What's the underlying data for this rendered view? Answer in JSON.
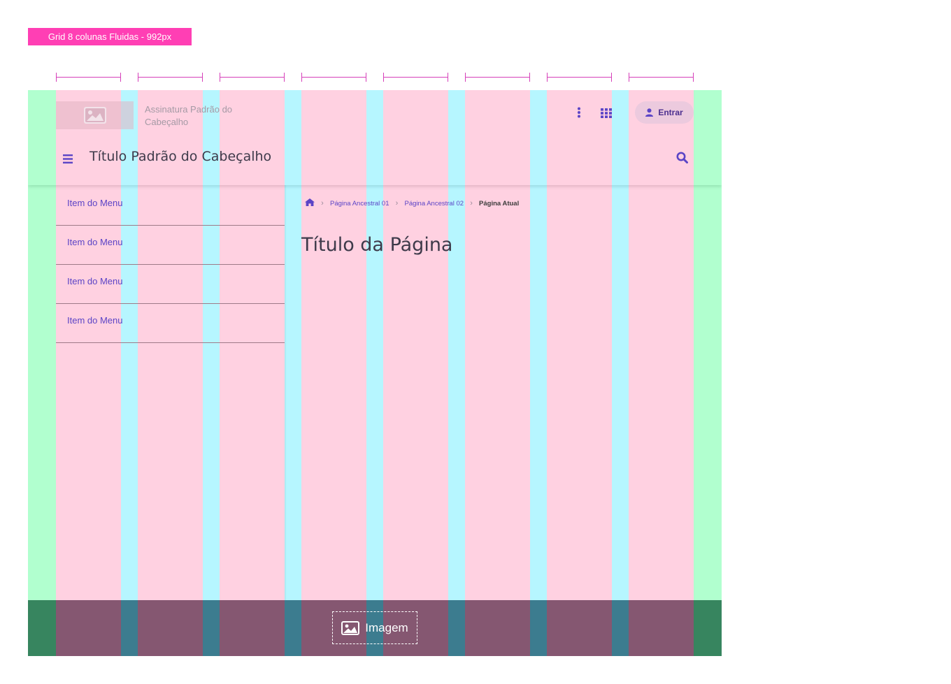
{
  "annotation": {
    "grid_label": "Grid 8 colunas Fluidas - 992px",
    "columns": 8
  },
  "colors": {
    "accent": "#5b44c6",
    "grid_label_bg": "#ff3fb4",
    "column": "#ffa4c4",
    "gutter": "#6eeeff",
    "margin": "#64ffa0",
    "footer": "#0a0a1e"
  },
  "header": {
    "logo_icon": "image-icon",
    "signature": "Assinatura Padrão do Cabeçalho",
    "more_icon": "kebab-icon",
    "apps_icon": "apps-grid-icon",
    "login_label": "Entrar",
    "menu_icon": "hamburger-icon",
    "title": "Título Padrão do Cabeçalho",
    "search_icon": "search-icon"
  },
  "menu": {
    "items": [
      {
        "label": "Item do Menu"
      },
      {
        "label": "Item do Menu"
      },
      {
        "label": "Item do Menu"
      },
      {
        "label": "Item do Menu"
      }
    ]
  },
  "breadcrumb": {
    "home_icon": "home-icon",
    "items": [
      {
        "label": "Página Ancestral 01"
      },
      {
        "label": "Página Ancestral 02"
      }
    ],
    "current": "Página Atual"
  },
  "page": {
    "title": "Título da Página"
  },
  "footer": {
    "image_icon": "image-icon",
    "image_label": "Imagem"
  }
}
